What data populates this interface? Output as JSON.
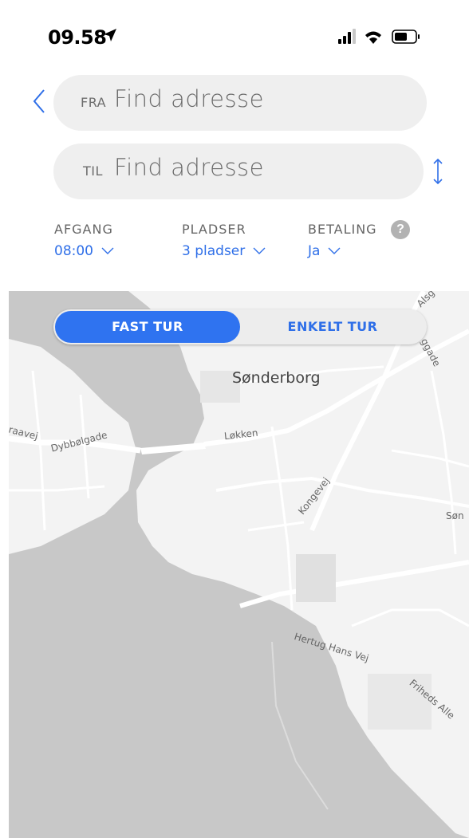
{
  "status": {
    "time": "09.58"
  },
  "search": {
    "from_prefix": "FRA",
    "from_placeholder": "Find adresse",
    "to_prefix": "TIL",
    "to_placeholder": "Find adresse"
  },
  "options": {
    "departure_label": "AFGANG",
    "departure_value": "08:00",
    "seats_label": "PLADSER",
    "seats_value": "3 pladser",
    "payment_label": "BETALING",
    "payment_value": "Ja",
    "help_symbol": "?"
  },
  "trip_type": {
    "fixed": "FAST TUR",
    "single": "ENKELT TUR",
    "selected": "FAST TUR"
  },
  "map": {
    "labels": {
      "city": "Sønderborg",
      "dybbolgade": "Dybbølgade",
      "lokken": "Løkken",
      "kongevej": "Kongevej",
      "hertug": "Hertug Hans Vej",
      "friheds": "Friheds Alle",
      "graavej": "nraavej",
      "alsg": "Alsg",
      "ggade": "ggade",
      "son": "Søn"
    }
  },
  "colors": {
    "accent": "#2f73f0",
    "field_bg": "#efefef",
    "water": "#c8c8c8",
    "land": "#f3f3f3"
  },
  "icons": {
    "back": "chevron-left-icon",
    "swap": "swap-vertical-icon",
    "location": "location-arrow-icon",
    "help": "question-circle-icon"
  }
}
